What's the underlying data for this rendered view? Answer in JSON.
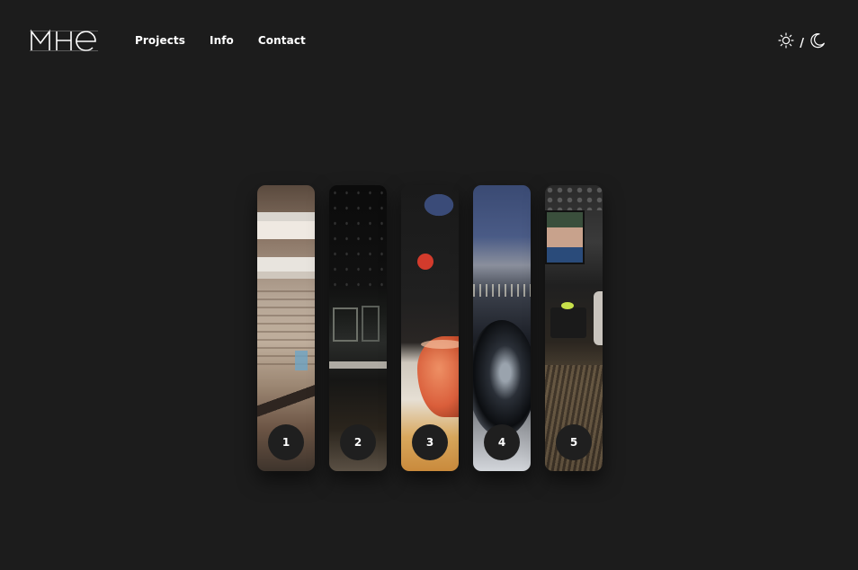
{
  "header": {
    "logo_alt": "MHe",
    "nav": [
      {
        "label": "Projects"
      },
      {
        "label": "Info"
      },
      {
        "label": "Contact"
      }
    ],
    "theme_toggle": {
      "light_icon": "sun-icon",
      "separator": "/",
      "dark_icon": "moon-icon"
    }
  },
  "gallery": {
    "strips": [
      {
        "number": "1",
        "scene": "hallway"
      },
      {
        "number": "2",
        "scene": "night-street"
      },
      {
        "number": "3",
        "scene": "drink"
      },
      {
        "number": "4",
        "scene": "reflective-sculpture"
      },
      {
        "number": "5",
        "scene": "bar-lounge"
      }
    ]
  },
  "colors": {
    "background": "#1c1c1c",
    "text": "#ffffff",
    "badge": "#1f1f1f"
  }
}
